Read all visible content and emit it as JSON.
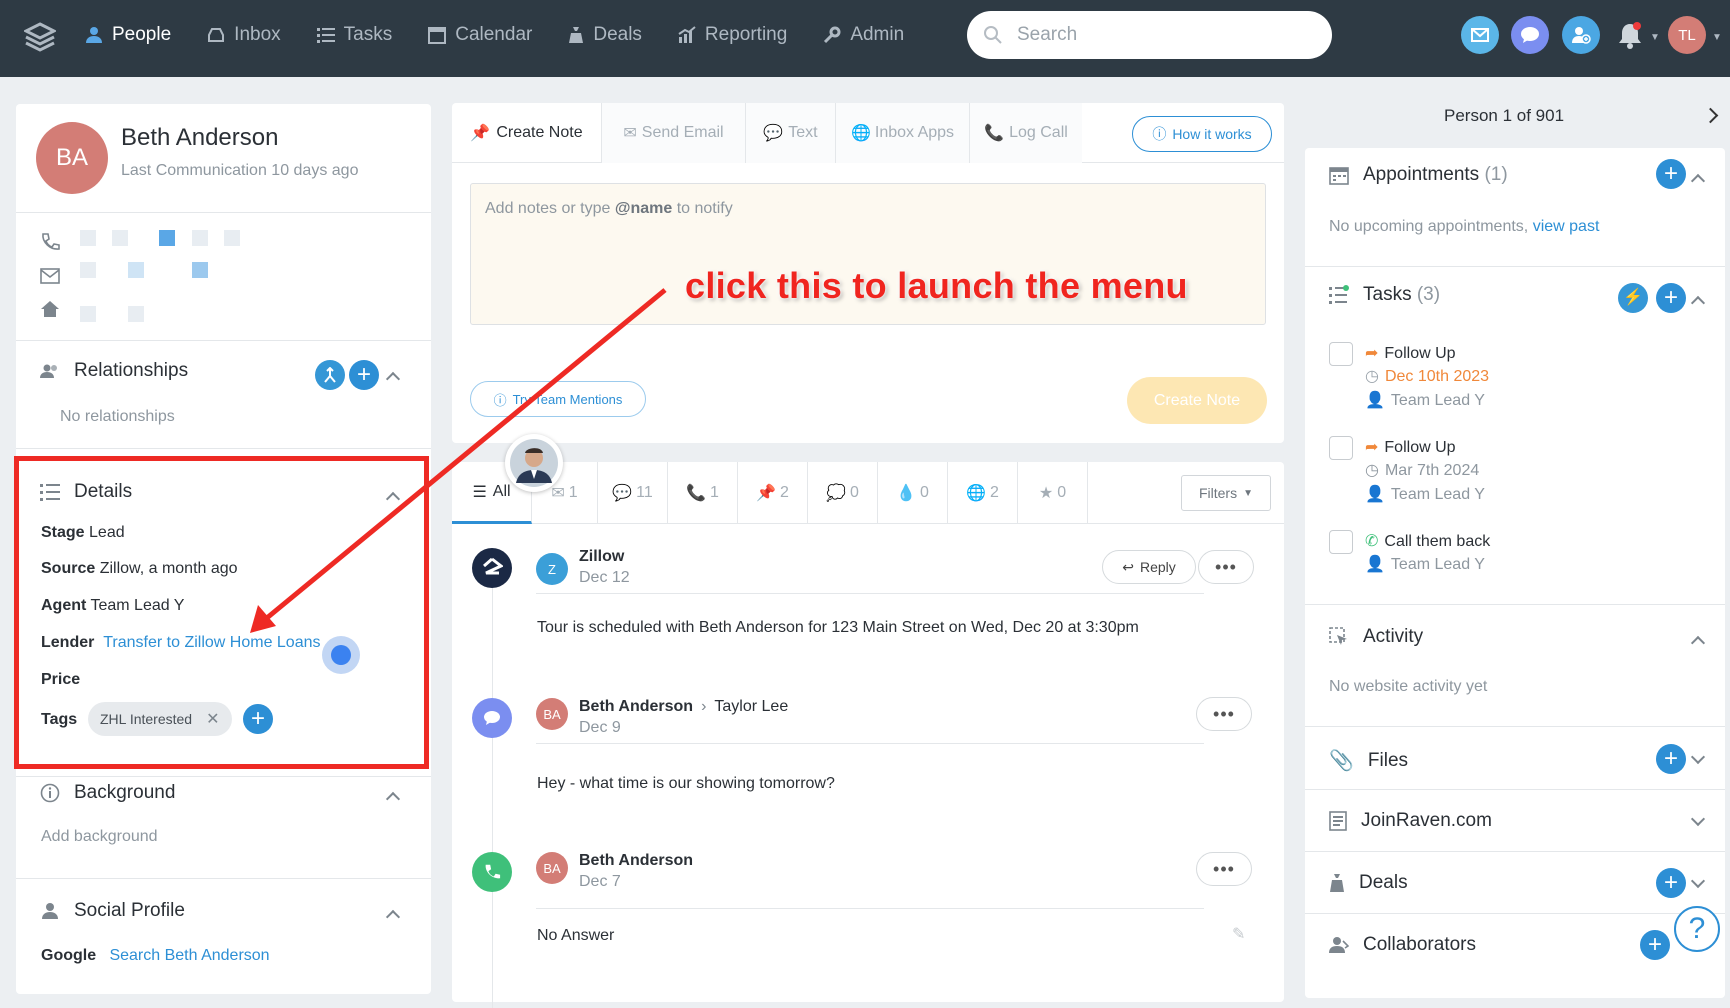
{
  "topbar": {
    "nav": [
      {
        "label": "People",
        "icon": "person-icon",
        "active": true
      },
      {
        "label": "Inbox",
        "icon": "inbox-icon"
      },
      {
        "label": "Tasks",
        "icon": "list-icon"
      },
      {
        "label": "Calendar",
        "icon": "calendar-icon"
      },
      {
        "label": "Deals",
        "icon": "money-bag-icon"
      },
      {
        "label": "Reporting",
        "icon": "chart-icon"
      },
      {
        "label": "Admin",
        "icon": "wrench-icon"
      }
    ],
    "search_placeholder": "Search",
    "user_initials": "TL"
  },
  "person": {
    "initials": "BA",
    "name": "Beth Anderson",
    "last_communication": "Last Communication 10 days ago"
  },
  "relationships": {
    "title": "Relationships",
    "empty": "No relationships"
  },
  "details": {
    "title": "Details",
    "stage_label": "Stage",
    "stage_value": "Lead",
    "source_label": "Source",
    "source_value": "Zillow, a month ago",
    "agent_label": "Agent",
    "agent_value": "Team Lead Y",
    "lender_label": "Lender",
    "lender_value": "Transfer to Zillow Home Loans",
    "price_label": "Price",
    "tags_label": "Tags",
    "tag": "ZHL Interested"
  },
  "background": {
    "title": "Background",
    "placeholder": "Add background"
  },
  "social": {
    "title": "Social Profile",
    "google_label": "Google",
    "google_link": "Search Beth Anderson"
  },
  "composer": {
    "tabs": [
      "Create Note",
      "Send Email",
      "Text",
      "Inbox Apps",
      "Log Call"
    ],
    "how_it_works": "How it works",
    "placeholder_pre": "Add notes or type ",
    "placeholder_bold": "@name",
    "placeholder_post": " to notify",
    "team_mentions": "Try Team Mentions",
    "create_btn": "Create Note"
  },
  "feed_tabs": {
    "all": "All",
    "counts": [
      "1",
      "11",
      "1",
      "2",
      "0",
      "0",
      "2",
      "0"
    ],
    "filters": "Filters"
  },
  "feed": [
    {
      "avatar": "Z",
      "name": "Zillow",
      "date": "Dec 12",
      "body": "Tour is scheduled with Beth Anderson for 123 Main Street on Wed, Dec 20 at 3:30pm",
      "reply": "Reply"
    },
    {
      "avatar": "BA",
      "name": "Beth Anderson",
      "to": "Taylor Lee",
      "date": "Dec 9",
      "body": "Hey - what time is our showing tomorrow?"
    },
    {
      "avatar": "BA",
      "name": "Beth Anderson",
      "date": "Dec 7",
      "body": "No Answer"
    }
  ],
  "right": {
    "pager": "Person 1 of 901",
    "appointments_title": "Appointments",
    "appointments_count": "(1)",
    "appointments_empty": "No upcoming appointments,",
    "view_past": "view past",
    "tasks_title": "Tasks",
    "tasks_count": "(3)",
    "tasks": [
      {
        "title": "Follow Up",
        "date": "Dec 10th 2023",
        "assignee": "Team Lead Y"
      },
      {
        "title": "Follow Up",
        "date": "Mar 7th 2024",
        "assignee": "Team Lead Y"
      },
      {
        "title": "Call them back",
        "assignee": "Team Lead Y"
      }
    ],
    "activity_title": "Activity",
    "activity_empty": "No website activity yet",
    "files_title": "Files",
    "joinraven_title": "JoinRaven.com",
    "deals_title": "Deals",
    "collaborators_title": "Collaborators"
  },
  "annotation": "click this to launch the menu",
  "colors": {
    "topbar": "#2e3a44",
    "accent": "#2d8fd5",
    "annotation_red": "#ee2a24"
  }
}
